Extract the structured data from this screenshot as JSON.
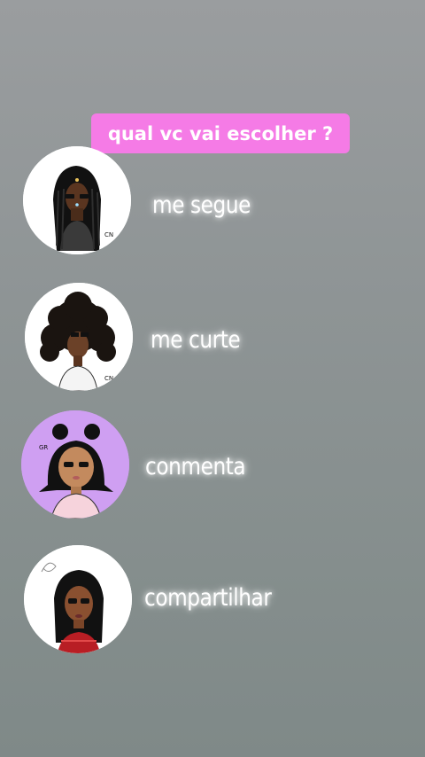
{
  "title": "qual vc vai escolher ?",
  "options": [
    {
      "label": "me segue",
      "avatar_tag": "CN"
    },
    {
      "label": "me curte",
      "avatar_tag": "CN"
    },
    {
      "label": "conmenta",
      "avatar_tag": "GR"
    },
    {
      "label": "compartilhar"
    }
  ],
  "colors": {
    "title_background": "#f57be6",
    "avatar_3_background": "#cf9ff2"
  }
}
